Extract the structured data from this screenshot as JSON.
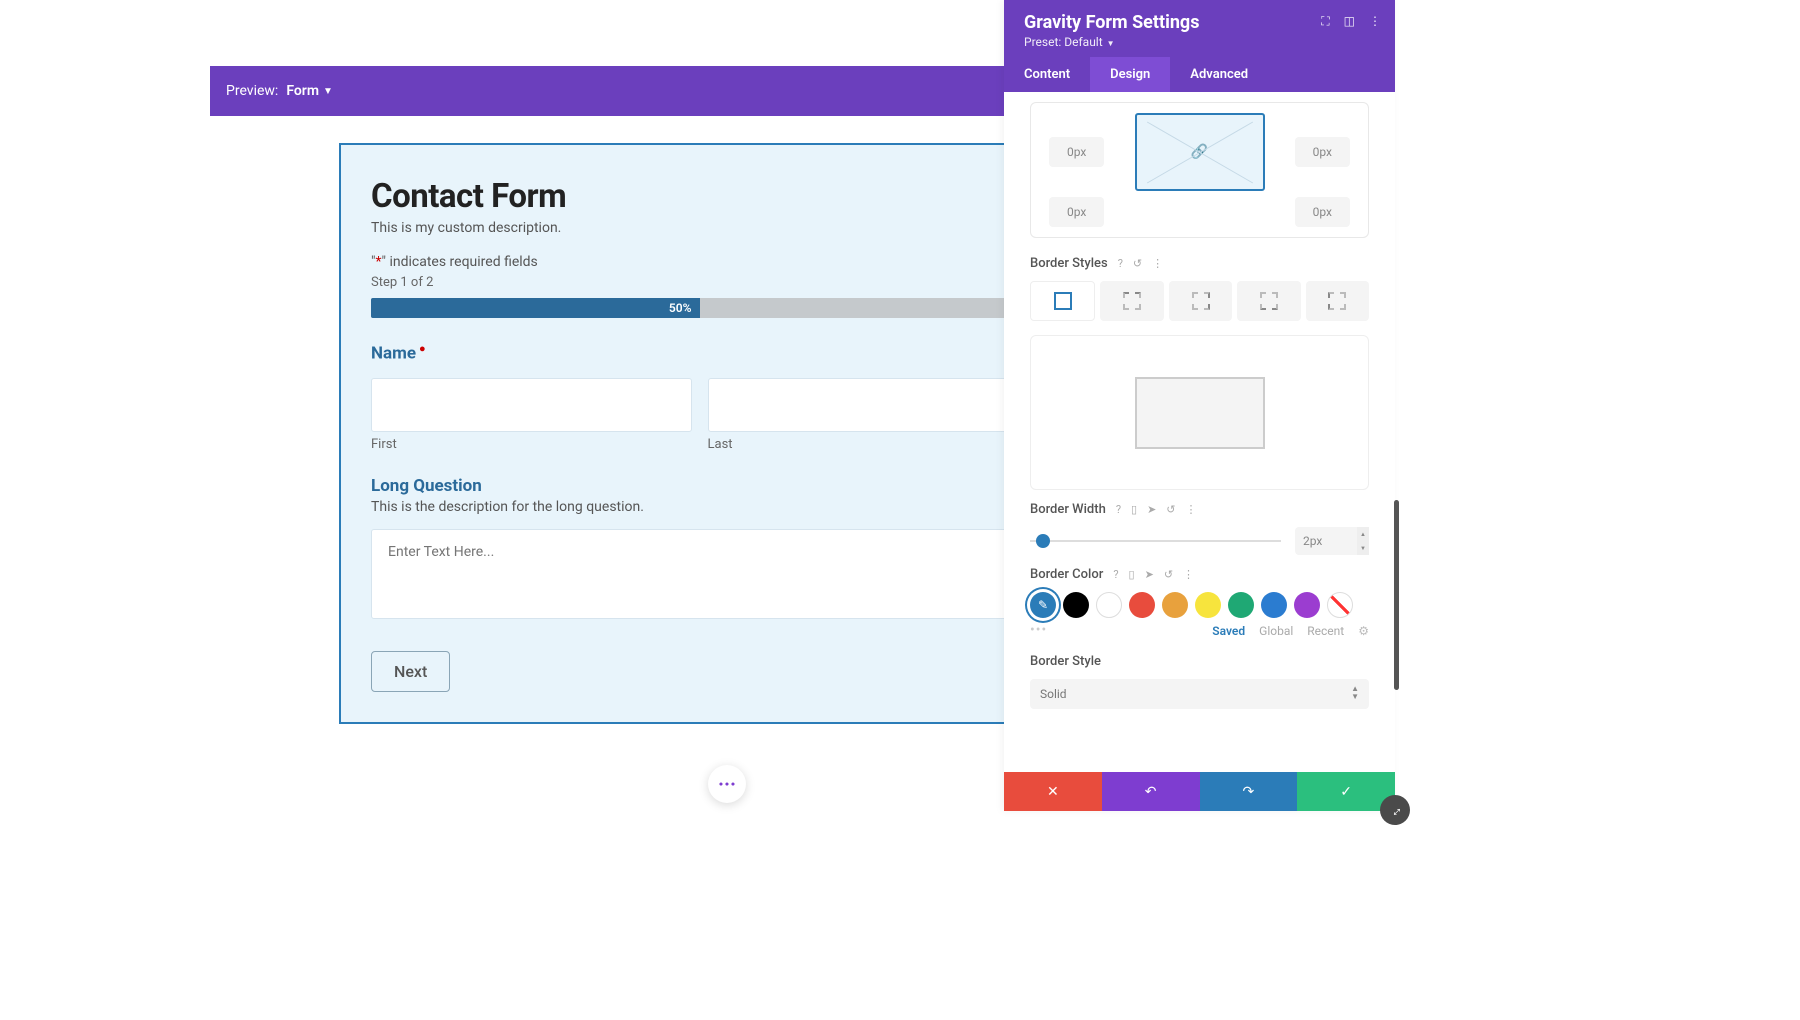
{
  "preview": {
    "label": "Preview:",
    "value": "Form"
  },
  "form": {
    "title": "Contact Form",
    "description": "This is my custom description.",
    "required_note_pre": "\"",
    "required_note_ast": "*",
    "required_note_post": "\" indicates required fields",
    "step": "Step 1 of 2",
    "progress": "50%",
    "name": {
      "label": "Name",
      "first": "First",
      "last": "Last"
    },
    "long": {
      "label": "Long Question",
      "desc": "This is the description for the long question.",
      "placeholder": "Enter Text Here..."
    },
    "next": "Next"
  },
  "panel": {
    "title": "Gravity Form Settings",
    "preset": "Preset: Default",
    "tabs": {
      "content": "Content",
      "design": "Design",
      "advanced": "Advanced"
    },
    "margin": {
      "tl": "0px",
      "tr": "0px",
      "bl": "0px",
      "br": "0px"
    },
    "border_styles_label": "Border Styles",
    "border_width": {
      "label": "Border Width",
      "value": "2px"
    },
    "border_color": {
      "label": "Border Color",
      "tabs": {
        "saved": "Saved",
        "global": "Global",
        "recent": "Recent"
      },
      "palette": [
        {
          "name": "black",
          "hex": "#000000"
        },
        {
          "name": "white",
          "hex": "#ffffff"
        },
        {
          "name": "red",
          "hex": "#e84c3d"
        },
        {
          "name": "orange",
          "hex": "#e8a13d"
        },
        {
          "name": "yellow",
          "hex": "#f7e43d"
        },
        {
          "name": "green",
          "hex": "#1fa874"
        },
        {
          "name": "blue",
          "hex": "#2b7cd0"
        },
        {
          "name": "purple",
          "hex": "#9b3dd0"
        }
      ]
    },
    "border_style": {
      "label": "Border Style",
      "value": "Solid"
    }
  }
}
